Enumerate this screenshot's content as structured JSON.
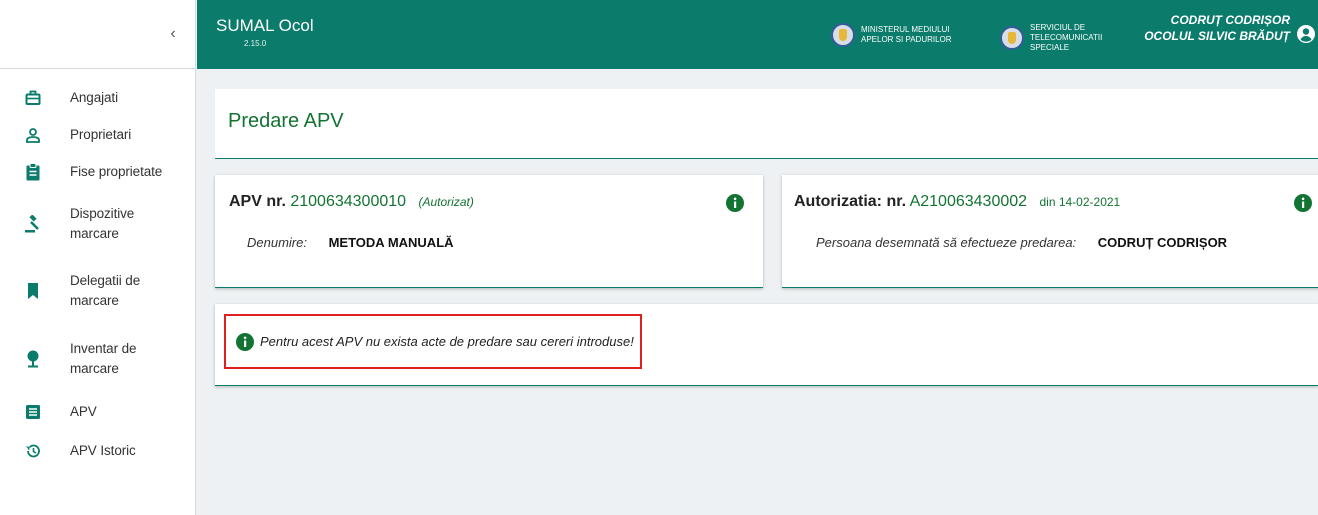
{
  "app": {
    "title": "SUMAL Ocol",
    "version": "2.15.0"
  },
  "header": {
    "ministry": "MINISTERUL MEDIULUI APELOR SI PADURILOR",
    "service": "SERVICIUL DE TELECOMUNICATII SPECIALE",
    "user_name": "CODRUȚ CODRIȘOR",
    "user_unit": "OCOLUL SILVIC BRĂDUȚ"
  },
  "sidebar": {
    "collapse_glyph": "‹",
    "items": [
      {
        "label": "Angajati",
        "icon": "briefcase-icon"
      },
      {
        "label": "Proprietari",
        "icon": "person-icon"
      },
      {
        "label": "Fise proprietate",
        "icon": "clipboard-icon"
      },
      {
        "label": "Dispozitive marcare",
        "icon": "gavel-icon"
      },
      {
        "label": "Delegatii de marcare",
        "icon": "bookmark-icon"
      },
      {
        "label": "Inventar de marcare",
        "icon": "tree-icon"
      },
      {
        "label": "APV",
        "icon": "document-icon"
      },
      {
        "label": "APV Istoric",
        "icon": "history-icon"
      }
    ]
  },
  "page": {
    "title": "Predare APV"
  },
  "apv_card": {
    "title_label": "APV nr.",
    "number": "2100634300010",
    "status": "(Autorizat)",
    "denumire_label": "Denumire:",
    "denumire_value": "METODA MANUALĂ"
  },
  "autorizatie_card": {
    "title_label": "Autorizatia: nr.",
    "number": "A210063430002",
    "date": "din 14-02-2021",
    "persoana_label": "Persoana desemnată să efectueze predarea:",
    "persoana_value": "CODRUȚ CODRIȘOR"
  },
  "notice": {
    "text": "Pentru acest APV nu exista acte de predare sau cereri introduse!"
  },
  "colors": {
    "primary": "#0b7b6b",
    "accent_green": "#137333",
    "alert_border": "#e02020"
  }
}
